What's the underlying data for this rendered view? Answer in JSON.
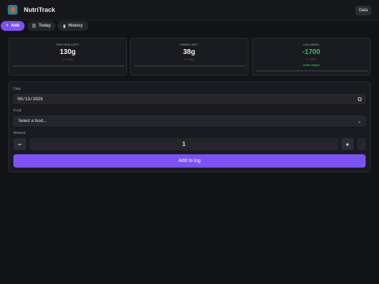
{
  "app": {
    "title": "NutriTrack"
  },
  "header": {
    "data_button": "Data"
  },
  "tabs": [
    {
      "label": "Add",
      "icon": "plus-icon",
      "active": true
    },
    {
      "label": "Today",
      "icon": "list-icon",
      "active": false
    },
    {
      "label": "History",
      "icon": "bar-chart-icon",
      "active": false
    }
  ],
  "stats": [
    {
      "label": "PROTEIN LEFT",
      "value": "130g",
      "sub": "0 / 130g"
    },
    {
      "label": "FIBER LEFT",
      "value": "38g",
      "sub": "0 / 38g"
    },
    {
      "label": "CALORIES",
      "value": "-1700",
      "sub": "0 / 1700",
      "note": "under target",
      "value_color": "#22c55e"
    }
  ],
  "form": {
    "date_label": "Date",
    "date_value": "08/13/2026",
    "food_label": "Food",
    "food_selected": "Select a food...",
    "amount_label": "Amount",
    "amount_value": "1",
    "minus_label": "−",
    "plus_label": "+",
    "submit_label": "Add to log"
  },
  "colors": {
    "accent": "#7b52f6",
    "positive": "#22c55e",
    "background": "#121316"
  }
}
